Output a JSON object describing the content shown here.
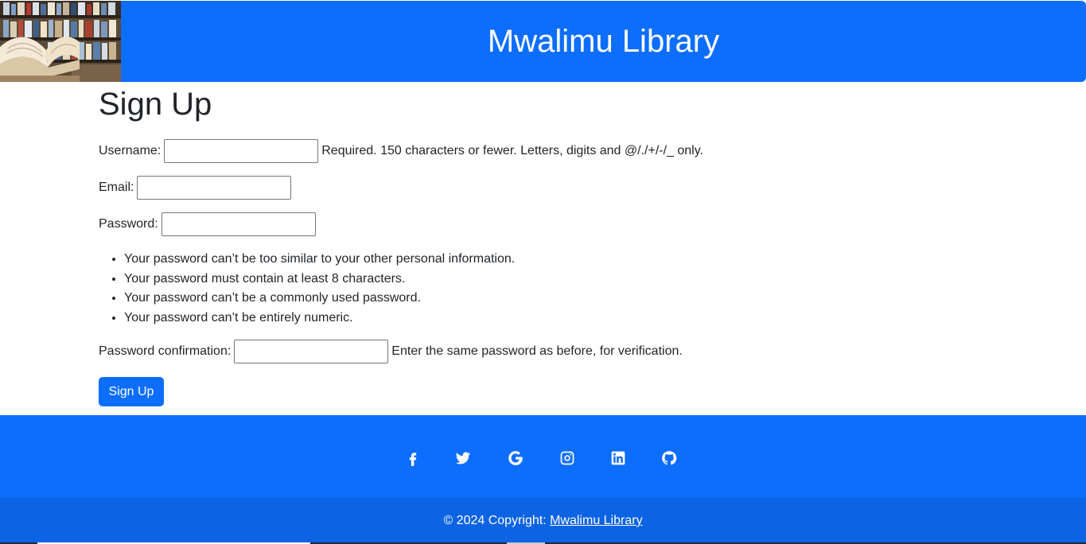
{
  "header": {
    "title": "Mwalimu Library"
  },
  "page": {
    "title": "Sign Up"
  },
  "form": {
    "username": {
      "label": "Username:",
      "value": "",
      "help": "Required. 150 characters or fewer. Letters, digits and @/./+/-/_ only."
    },
    "email": {
      "label": "Email:",
      "value": ""
    },
    "password": {
      "label": "Password:",
      "value": "",
      "rules": [
        "Your password can’t be too similar to your other personal information.",
        "Your password must contain at least 8 characters.",
        "Your password can’t be a commonly used password.",
        "Your password can’t be entirely numeric."
      ]
    },
    "password_confirmation": {
      "label": "Password confirmation:",
      "value": "",
      "help": "Enter the same password as before, for verification."
    },
    "submit_label": "Sign Up"
  },
  "footer": {
    "social_icons": [
      "facebook-icon",
      "twitter-icon",
      "google-icon",
      "instagram-icon",
      "linkedin-icon",
      "github-icon"
    ],
    "copyright_prefix": "© 2024 Copyright:",
    "copyright_link": "Mwalimu Library"
  },
  "colors": {
    "primary": "#0d6efd",
    "footer_bottom": "#0c63e4",
    "text": "#212529"
  }
}
